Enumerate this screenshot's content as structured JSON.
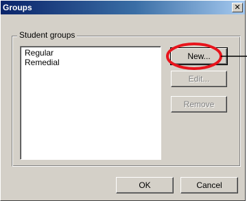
{
  "window": {
    "title": "Groups",
    "close_symbol": "✕"
  },
  "group": {
    "label": "Student groups",
    "items": [
      "Regular",
      "Remedial"
    ]
  },
  "buttons": {
    "new": "New...",
    "edit": "Edit...",
    "remove": "Remove",
    "ok": "OK",
    "cancel": "Cancel"
  },
  "colors": {
    "face": "#d4d0c8",
    "title_start": "#0a246a",
    "title_end": "#a6caf0",
    "highlight_circle": "#e8141c"
  },
  "annotation": {
    "shape": "red-ellipse",
    "target": "new-button",
    "pointer": "callout-line"
  }
}
